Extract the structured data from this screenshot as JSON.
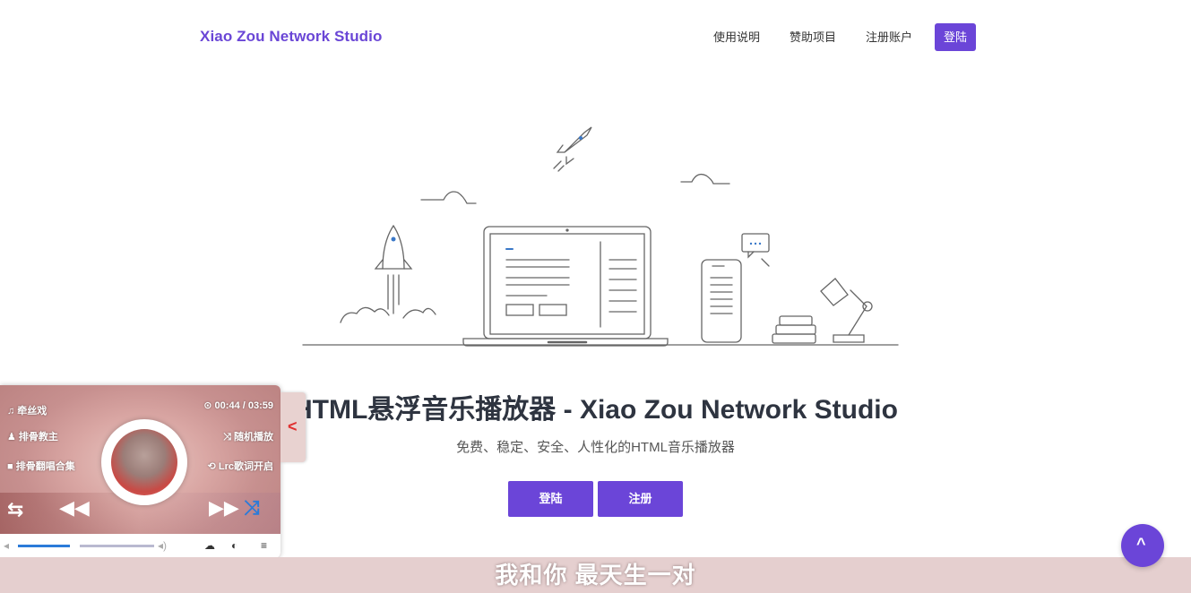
{
  "nav": {
    "brand": "Xiao Zou Network Studio",
    "links": [
      "使用说明",
      "赞助项目",
      "注册账户"
    ],
    "login": "登陆"
  },
  "hero": {
    "title": "HTML悬浮音乐播放器 - Xiao Zou Network Studio",
    "subtitle": "免费、稳定、安全、人性化的HTML音乐播放器",
    "login_button": "登陆",
    "register_button": "注册"
  },
  "player": {
    "song": "♫ 牵丝戏",
    "artist": "♟ 排骨教主",
    "album": "■ 排骨翻唱合集",
    "time": "⊙ 00:44 / 03:59",
    "mode": "⤨ 随机播放",
    "lyrics_status": "⟲ Lrc歌词开启",
    "progress": 0.18
  },
  "lyrics_line": "我和你 最天生一对",
  "colors": {
    "accent": "#6b45d8",
    "brand": "#6a46d6"
  },
  "icons": [
    "repeat-icon",
    "prev-icon",
    "next-icon",
    "shuffle-icon",
    "volume-icon",
    "download-icon",
    "toggle-icon",
    "menu-icon",
    "chevron-left-icon",
    "chevron-up-icon"
  ]
}
